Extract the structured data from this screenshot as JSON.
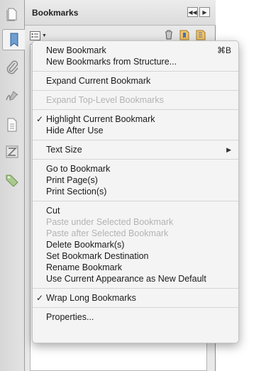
{
  "panel": {
    "title": "Bookmarks",
    "collapse_icon": "double-left-arrow-icon",
    "expand_icon": "right-arrow-icon"
  },
  "rail": {
    "items": [
      {
        "icon": "pages-icon"
      },
      {
        "icon": "bookmark-icon",
        "active": true
      },
      {
        "icon": "attachment-icon"
      },
      {
        "icon": "signature-icon"
      },
      {
        "icon": "content-icon"
      },
      {
        "icon": "order-icon"
      },
      {
        "icon": "tag-icon"
      }
    ]
  },
  "toolbar": {
    "options_icon": "options-menu-icon",
    "delete_icon": "trash-icon",
    "new_bookmark_icon": "new-bookmark-icon",
    "from_structure_icon": "bookmark-from-structure-icon"
  },
  "menu": {
    "groups": [
      [
        {
          "label": "New Bookmark",
          "shortcut": "⌘B"
        },
        {
          "label": "New Bookmarks from Structure..."
        }
      ],
      [
        {
          "label": "Expand Current Bookmark"
        }
      ],
      [
        {
          "label": "Expand Top-Level Bookmarks",
          "disabled": true
        }
      ],
      [
        {
          "label": "Highlight Current Bookmark",
          "checked": true
        },
        {
          "label": "Hide After Use"
        }
      ],
      [
        {
          "label": "Text Size",
          "submenu": true
        }
      ],
      [
        {
          "label": "Go to Bookmark"
        },
        {
          "label": "Print Page(s)"
        },
        {
          "label": "Print Section(s)"
        }
      ],
      [
        {
          "label": "Cut"
        },
        {
          "label": "Paste under Selected Bookmark",
          "disabled": true
        },
        {
          "label": "Paste after Selected Bookmark",
          "disabled": true
        },
        {
          "label": "Delete Bookmark(s)"
        },
        {
          "label": "Set Bookmark Destination"
        },
        {
          "label": "Rename Bookmark"
        },
        {
          "label": "Use Current Appearance as New Default"
        }
      ],
      [
        {
          "label": "Wrap Long Bookmarks",
          "checked": true
        }
      ],
      [
        {
          "label": "Properties..."
        }
      ]
    ],
    "check_glyph": "✓",
    "submenu_glyph": "▶"
  }
}
